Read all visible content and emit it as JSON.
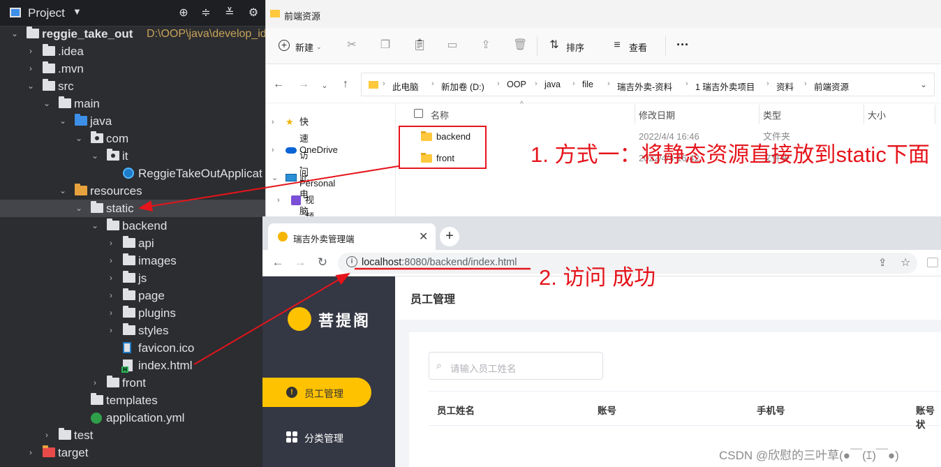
{
  "ide": {
    "panel_title": "Project",
    "tree": [
      {
        "label": "reggie_take_out",
        "path": "D:\\OOP\\java\\develop_id",
        "kind": "module"
      },
      {
        "label": ".idea",
        "kind": "folder"
      },
      {
        "label": ".mvn",
        "kind": "folder"
      },
      {
        "label": "src",
        "kind": "folder"
      },
      {
        "label": "main",
        "kind": "folder"
      },
      {
        "label": "java",
        "kind": "folder-blue"
      },
      {
        "label": "com",
        "kind": "package"
      },
      {
        "label": "it",
        "kind": "package"
      },
      {
        "label": "ReggieTakeOutApplicat",
        "kind": "class"
      },
      {
        "label": "resources",
        "kind": "folder-res"
      },
      {
        "label": "static",
        "kind": "folder",
        "selected": true
      },
      {
        "label": "backend",
        "kind": "folder"
      },
      {
        "label": "api",
        "kind": "folder"
      },
      {
        "label": "images",
        "kind": "folder"
      },
      {
        "label": "js",
        "kind": "folder"
      },
      {
        "label": "page",
        "kind": "folder"
      },
      {
        "label": "plugins",
        "kind": "folder"
      },
      {
        "label": "styles",
        "kind": "folder"
      },
      {
        "label": "favicon.ico",
        "kind": "ico"
      },
      {
        "label": "index.html",
        "kind": "html"
      },
      {
        "label": "front",
        "kind": "folder"
      },
      {
        "label": "templates",
        "kind": "folder"
      },
      {
        "label": "application.yml",
        "kind": "yml"
      },
      {
        "label": "test",
        "kind": "folder"
      },
      {
        "label": "target",
        "kind": "folder-red"
      }
    ]
  },
  "explorer": {
    "title": "前端资源",
    "cmd": {
      "new": "新建",
      "sort": "排序",
      "view": "查看",
      "more": "···"
    },
    "breadcrumb": [
      "此电脑",
      "新加卷 (D:)",
      "OOP",
      "java",
      "file",
      "瑞吉外卖-资料",
      "1 瑞吉外卖项目",
      "资料",
      "前端资源"
    ],
    "nav": [
      {
        "label": "快速访问",
        "icon": "star-icon"
      },
      {
        "label": "OneDrive - Personal",
        "icon": "cloud-icon"
      },
      {
        "label": "此电脑",
        "icon": "computer-icon"
      },
      {
        "label": "视频",
        "icon": "video-icon"
      }
    ],
    "columns": {
      "name": "名称",
      "modified": "修改日期",
      "type": "类型",
      "size": "大小"
    },
    "files": [
      {
        "name": "backend",
        "modified": "2022/4/4 16:46",
        "type": "文件夹"
      },
      {
        "name": "front",
        "modified": "2022/4/4 16:42",
        "type": "文件夹"
      }
    ]
  },
  "browser": {
    "tab_title": "瑞吉外卖管理端",
    "url_host": "localhost",
    "url_rest": ":8080/backend/index.html",
    "app": {
      "logo_text": "菩提阁",
      "menu": [
        {
          "label": "员工管理",
          "active": true
        },
        {
          "label": "分类管理",
          "active": false
        }
      ],
      "page_title": "员工管理",
      "search_placeholder": "请输入员工姓名",
      "table_headers": [
        "员工姓名",
        "账号",
        "手机号",
        "账号状"
      ]
    }
  },
  "annotations": {
    "step1": "1. 方式一：将静态资源直接放到static下面",
    "step2": "2. 访问 成功",
    "color": "#e5141b"
  },
  "watermark": "CSDN @欣慰的三叶草(●￣(ｴ)￣●)"
}
